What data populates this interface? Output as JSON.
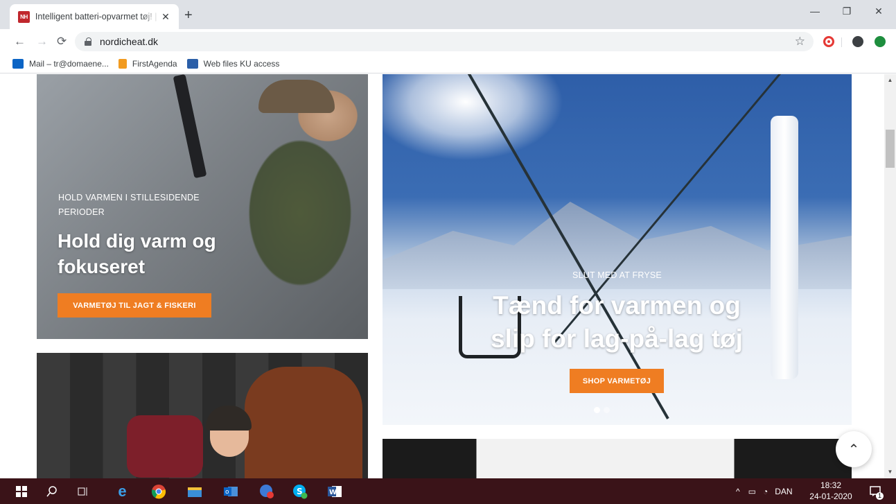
{
  "browser": {
    "tab": {
      "favicon_text": "NH",
      "title": "Intelligent batteri-opvarmet tøj! | Nordic Heat"
    },
    "new_tab_symbol": "+",
    "window_controls": {
      "minimize": "—",
      "restore": "❐",
      "close": "✕"
    },
    "url": "nordicheat.dk",
    "bookmarks": [
      {
        "label": "Mail – tr@domaene..."
      },
      {
        "label": "FirstAgenda"
      },
      {
        "label": "Web files KU access"
      }
    ]
  },
  "page": {
    "hunt_tile": {
      "eyebrow": "HOLD VARMEN I STILLESIDENDE PERIODER",
      "headline": "Hold dig varm og fokuseret",
      "cta": "VARMETØJ TIL JAGT & FISKERI"
    },
    "slider": {
      "eyebrow": "SLUT MED AT FRYSE",
      "headline": "Tænd for varmen og slip for lag-på-lag tøj",
      "cta": "SHOP VARMETØJ",
      "dots": 2,
      "active_dot": 1
    },
    "to_top_symbol": "⌃"
  },
  "taskbar": {
    "language": "DAN",
    "time": "18:32",
    "date": "24-01-2020",
    "notification_count": "1"
  },
  "colors": {
    "accent": "#ef7d22",
    "taskbar": "#3a1318",
    "brand_red": "#c0272d"
  }
}
